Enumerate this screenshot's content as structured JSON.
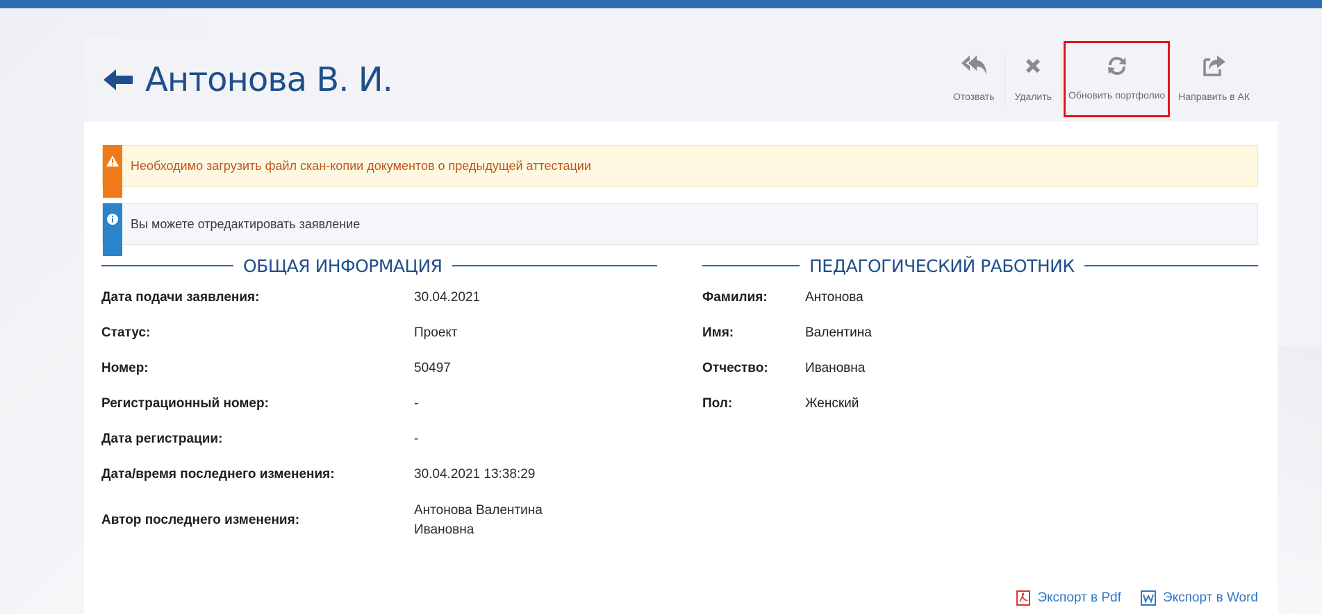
{
  "header": {
    "title": "Антонова В. И."
  },
  "actions": [
    {
      "label": "Отозвать",
      "icon": "reply-all-icon"
    },
    {
      "label": "Удалить",
      "icon": "close-icon"
    },
    {
      "label": "Обновить портфолио",
      "icon": "refresh-icon"
    },
    {
      "label": "Направить в АК",
      "icon": "share-icon"
    }
  ],
  "alerts": {
    "warning": "Необходимо загрузить файл скан-копии документов о предыдущей аттестации",
    "info": "Вы можете отредактировать заявление"
  },
  "sections": {
    "general": "ОБЩАЯ ИНФОРМАЦИЯ",
    "teacher": "ПЕДАГОГИЧЕСКИЙ РАБОТНИК"
  },
  "general_info": [
    {
      "key": "Дата подачи заявления:",
      "value": "30.04.2021"
    },
    {
      "key": "Статус:",
      "value": "Проект"
    },
    {
      "key": "Номер:",
      "value": "50497"
    },
    {
      "key": "Регистрационный номер:",
      "value": "-"
    },
    {
      "key": "Дата регистрации:",
      "value": "-"
    },
    {
      "key": "Дата/время последнего изменения:",
      "value": "30.04.2021 13:38:29"
    },
    {
      "key": "Автор последнего изменения:",
      "value_line1": "Антонова Валентина",
      "value_line2": "Ивановна"
    }
  ],
  "teacher_info": [
    {
      "key": "Фамилия:",
      "value": "Антонова"
    },
    {
      "key": "Имя:",
      "value": "Валентина"
    },
    {
      "key": "Отчество:",
      "value": "Ивановна"
    },
    {
      "key": "Пол:",
      "value": "Женский"
    }
  ],
  "exports": {
    "pdf": "Экспорт в Pdf",
    "word": "Экспорт в Word"
  },
  "colors": {
    "accent": "#2a6db3",
    "title": "#1f4f8b",
    "warning_flag": "#f07a1a",
    "info_flag": "#2b83c9",
    "highlight": "#e4141c"
  }
}
